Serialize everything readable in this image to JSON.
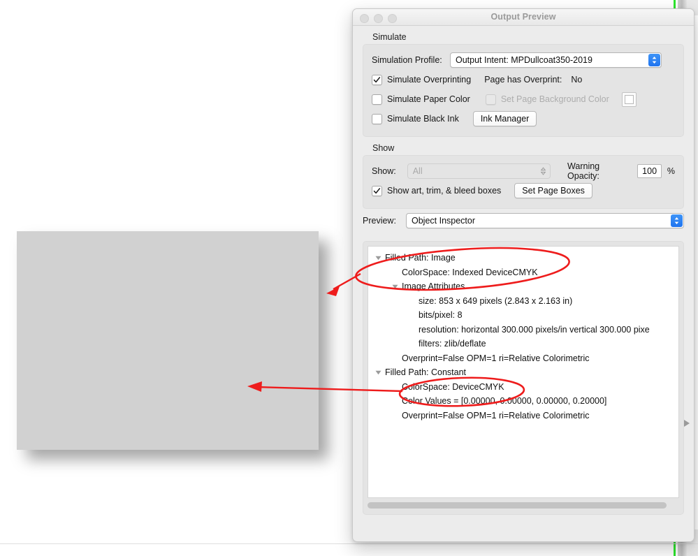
{
  "window": {
    "title": "Output Preview",
    "traffic_lights": [
      "close",
      "minimize",
      "maximize"
    ]
  },
  "simulate": {
    "group_label": "Simulate",
    "profile_label": "Simulation Profile:",
    "profile_value": "Output Intent: MPDullcoat350-2019",
    "simulate_overprinting_label": "Simulate Overprinting",
    "simulate_overprinting_checked": true,
    "page_has_overprint_label": "Page has Overprint:",
    "page_has_overprint_value": "No",
    "simulate_paper_color_label": "Simulate Paper Color",
    "simulate_paper_color_checked": false,
    "set_page_background_color_label": "Set Page Background Color",
    "set_page_background_color_checked": false,
    "set_page_background_color_enabled": false,
    "background_color_swatch": "#ffffff",
    "simulate_black_ink_label": "Simulate Black Ink",
    "simulate_black_ink_checked": false,
    "ink_manager_label": "Ink Manager"
  },
  "show": {
    "group_label": "Show",
    "show_label": "Show:",
    "show_value": "All",
    "show_enabled": false,
    "warning_opacity_label": "Warning Opacity:",
    "warning_opacity_value": "100",
    "percent_label": "%",
    "show_boxes_label": "Show art, trim, & bleed boxes",
    "show_boxes_checked": true,
    "set_page_boxes_label": "Set Page Boxes"
  },
  "preview": {
    "label": "Preview:",
    "value": "Object Inspector"
  },
  "inspector": {
    "rows": [
      {
        "indent": 0,
        "triangle": "down",
        "text": "Filled Path: Image"
      },
      {
        "indent": 1,
        "triangle": "none",
        "text": "ColorSpace: Indexed DeviceCMYK"
      },
      {
        "indent": 1,
        "triangle": "down",
        "text": "Image Attributes"
      },
      {
        "indent": 2,
        "triangle": "none",
        "text": "size: 853 x 649 pixels (2.843 x 2.163 in)"
      },
      {
        "indent": 2,
        "triangle": "none",
        "text": "bits/pixel: 8"
      },
      {
        "indent": 2,
        "triangle": "none",
        "text": "resolution: horizontal 300.000 pixels/in vertical 300.000 pixe"
      },
      {
        "indent": 2,
        "triangle": "none",
        "text": "filters: zlib/deflate"
      },
      {
        "indent": 1,
        "triangle": "none",
        "text": "Overprint=False OPM=1 ri=Relative Colorimetric"
      },
      {
        "indent": 0,
        "triangle": "down",
        "text": "Filled Path: Constant"
      },
      {
        "indent": 1,
        "triangle": "none",
        "text": "ColorSpace: DeviceCMYK"
      },
      {
        "indent": 1,
        "triangle": "none",
        "text": "Color Values = [0.00000, 0.00000, 0.00000, 0.20000]"
      },
      {
        "indent": 1,
        "triangle": "none",
        "text": "Overprint=False OPM=1 ri=Relative Colorimetric"
      }
    ]
  },
  "annotations": {
    "color": "#ee1c1c",
    "ellipse_1_target": "Filled Path: Image / ColorSpace: Indexed DeviceCMYK",
    "ellipse_2_target": "ColorSpace: DeviceCMYK",
    "arrow_1_target": "page-image-area",
    "arrow_2_target": "page-background-fill"
  },
  "document": {
    "page_fill": "#d1d1d1"
  }
}
